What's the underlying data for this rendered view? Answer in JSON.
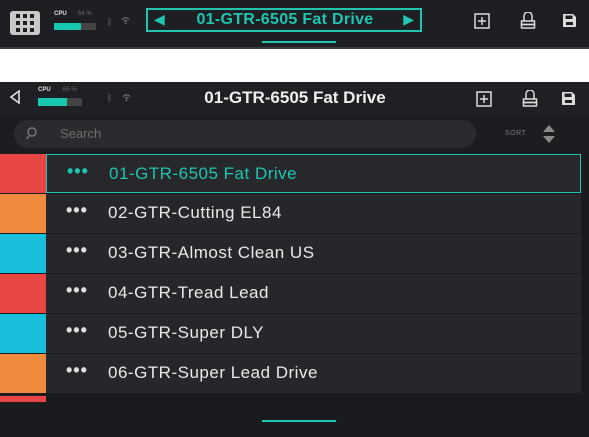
{
  "top_bar": {
    "cpu_label": "CPU",
    "cpu_percent_text": "64 %",
    "cpu_load": 0.64,
    "preset_name": "01-GTR-6505 Fat Drive",
    "icons": [
      "grid-menu-icon",
      "bluetooth-icon",
      "wifi-icon",
      "prev-arrow-icon",
      "next-arrow-icon",
      "add-icon",
      "tuner-icon",
      "save-icon"
    ]
  },
  "main": {
    "cpu_label": "CPU",
    "cpu_percent_text": "65 %",
    "cpu_load": 0.65,
    "title": "01-GTR-6505 Fat Drive",
    "search": {
      "placeholder": "Search"
    },
    "sort_label": "SORT",
    "presets": [
      {
        "label": "01-GTR-6505 Fat Drive",
        "color": "#e84545",
        "selected": true
      },
      {
        "label": "02-GTR-Cutting EL84",
        "color": "#f08a3c",
        "selected": false
      },
      {
        "label": "03-GTR-Almost Clean US",
        "color": "#17bfdb",
        "selected": false
      },
      {
        "label": "04-GTR-Tread Lead",
        "color": "#e84545",
        "selected": false
      },
      {
        "label": "05-GTR-Super DLY",
        "color": "#17bfdb",
        "selected": false
      },
      {
        "label": "06-GTR-Super Lead Drive",
        "color": "#f08a3c",
        "selected": false
      }
    ]
  },
  "colors": {
    "accent": "#1fc5b0",
    "background": "#1a1b1e",
    "row": "#26272b"
  }
}
